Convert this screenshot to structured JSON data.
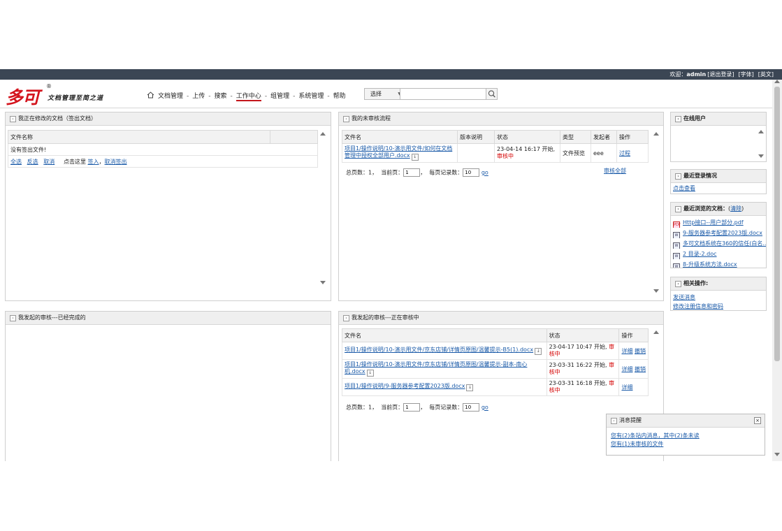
{
  "topbar": {
    "welcome": "欢迎：",
    "user": "admin",
    "logout": "[退出登录]",
    "font": "[字体]",
    "lang": "[英文]"
  },
  "logo": {
    "mark": "多可",
    "reg": "®",
    "slogan": "文档管理至简之道"
  },
  "nav": {
    "items": [
      "文档管理",
      "上传",
      "搜索",
      "工作中心",
      "组管理",
      "系统管理",
      "帮助"
    ],
    "active_index": 3
  },
  "search": {
    "select_label": "选择",
    "placeholder": ""
  },
  "editing": {
    "title": "我正在修改的文档（签出文档）",
    "col_name": "文件名称",
    "empty": "没有签出文件!",
    "actions": {
      "select_all": "全选",
      "invert": "反选",
      "cancel": "取消",
      "hint": "点击这里",
      "checkin": "签入",
      "cancel_checkout": "取消签出"
    },
    "comma": "，"
  },
  "pending": {
    "title": "我的未审核流程",
    "headers": [
      "文件名",
      "版本说明",
      "状态",
      "类型",
      "发起者",
      "操作"
    ],
    "rows": [
      {
        "file": "项目1/操作说明/10-演示用文件/如何在文档管理中授权全部用户.docx",
        "version": "",
        "status": "23-04-14 16:17 开始,",
        "status_red": "审核中",
        "type": "文件预览",
        "initiator": "eee",
        "action": "过程"
      }
    ],
    "pager": {
      "total_label": "总页数：",
      "total": "1",
      "current_label": "当前页：",
      "current": "1",
      "per_label": "每页记录数：",
      "per": "10",
      "go": "go"
    },
    "review_all": "审核全部"
  },
  "completed": {
    "title": "我发起的审核---已经完成的"
  },
  "inprogress": {
    "title": "我发起的审核---正在审核中",
    "headers": [
      "文件名",
      "状态",
      "操作"
    ],
    "rows": [
      {
        "file": "项目1/操作说明/10-演示用文件/京东店铺/详情页原图/温馨提示-B5(1).docx",
        "status": "23-04-17 10:47 开始,",
        "status_red": "审核中",
        "detail": "详细",
        "revoke": "撤销"
      },
      {
        "file": "项目1/操作说明/10-演示用文件/京东店铺/详情页原图/温馨提示-副本-南心机.docx",
        "status": "23-03-31 16:22 开始,",
        "status_red": "审核中",
        "detail": "详细",
        "revoke": "撤销"
      },
      {
        "file": "项目1/操作说明/9-服务器参考配置2023版.docx",
        "status": "23-03-31 16:18 开始,",
        "status_red": "审核中",
        "detail": "详细",
        "revoke": ""
      }
    ],
    "pager": {
      "total_label": "总页数：",
      "total": "1",
      "current_label": "当前页：",
      "current": "1",
      "per_label": "每页记录数：",
      "per": "10",
      "go": "go"
    }
  },
  "online": {
    "title": "在线用户"
  },
  "recent_login": {
    "title": "最近登录情况",
    "link": "点击查看"
  },
  "recent_docs": {
    "title": "最近浏览的文档：",
    "clear": "清除",
    "files": [
      {
        "name": "Http接口--用户部分.pdf",
        "icon": "pdf"
      },
      {
        "name": "9-服务器参考配置2023版.docx",
        "icon": "word"
      },
      {
        "name": "多可文档系统在360的信任(白名...",
        "icon": "word"
      },
      {
        "name": "2 目录-2.doc",
        "icon": "word"
      },
      {
        "name": "8-升级系统方法.docx",
        "icon": "word"
      }
    ]
  },
  "related": {
    "title": "相关操作:",
    "links": [
      "发送消息",
      "修改注册信息和密码"
    ]
  },
  "notice": {
    "title": "消息提醒",
    "lines": [
      "您有(2)条站内消息，其中(2)条未读",
      "您有(1)未审核的文件"
    ]
  }
}
